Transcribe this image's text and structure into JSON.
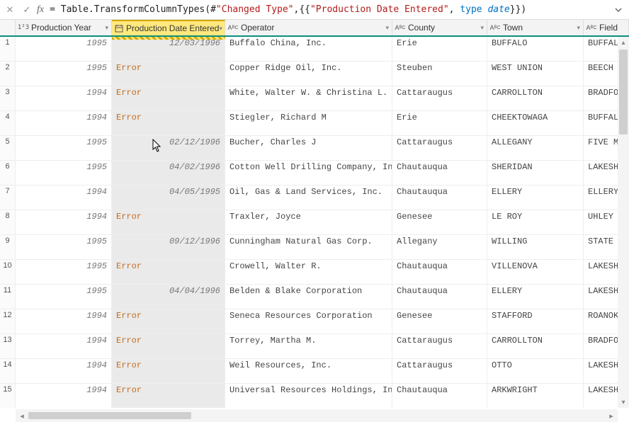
{
  "formula": {
    "prefix": "= Table.TransformColumnTypes(#",
    "str1": "\"Changed Type\"",
    "mid1": ",{{",
    "str2": "\"Production Date Entered\"",
    "mid2": ", ",
    "typ": "type",
    "mid3": " ",
    "dat": "date",
    "suffix": "}})"
  },
  "columns": {
    "prod_year": "Production Year",
    "prod_date": "Production Date Entered",
    "operator": "Operator",
    "county": "County",
    "town": "Town",
    "field": "Field"
  },
  "type_labels": {
    "num": "1²3",
    "txt": "AᴮC"
  },
  "error_label": "Error",
  "rows": [
    {
      "n": "1",
      "year": "1995",
      "date": "12/03/1996",
      "err": false,
      "op": "Buffalo China, Inc.",
      "county": "Erie",
      "town": "BUFFALO",
      "field": "BUFFALO"
    },
    {
      "n": "2",
      "year": "1995",
      "date": "",
      "err": true,
      "op": "Copper Ridge Oil, Inc.",
      "county": "Steuben",
      "town": "WEST UNION",
      "field": "BEECH H"
    },
    {
      "n": "3",
      "year": "1994",
      "date": "",
      "err": true,
      "op": "White, Walter W. & Christina L.",
      "county": "Cattaraugus",
      "town": "CARROLLTON",
      "field": "BRADFOR"
    },
    {
      "n": "4",
      "year": "1994",
      "date": "",
      "err": true,
      "op": "Stiegler, Richard M",
      "county": "Erie",
      "town": "CHEEKTOWAGA",
      "field": "BUFFALO"
    },
    {
      "n": "5",
      "year": "1995",
      "date": "02/12/1996",
      "err": false,
      "op": "Bucher, Charles J",
      "county": "Cattaraugus",
      "town": "ALLEGANY",
      "field": "FIVE MI"
    },
    {
      "n": "6",
      "year": "1995",
      "date": "04/02/1996",
      "err": false,
      "op": "Cotton Well Drilling Company,  Inc.",
      "county": "Chautauqua",
      "town": "SHERIDAN",
      "field": "LAKESHO"
    },
    {
      "n": "7",
      "year": "1994",
      "date": "04/05/1995",
      "err": false,
      "op": "Oil, Gas & Land Services, Inc.",
      "county": "Chautauqua",
      "town": "ELLERY",
      "field": "ELLERY"
    },
    {
      "n": "8",
      "year": "1994",
      "date": "",
      "err": true,
      "op": "Traxler, Joyce",
      "county": "Genesee",
      "town": "LE ROY",
      "field": "UHLEY C"
    },
    {
      "n": "9",
      "year": "1995",
      "date": "09/12/1996",
      "err": false,
      "op": "Cunningham Natural Gas Corp.",
      "county": "Allegany",
      "town": "WILLING",
      "field": "STATE L"
    },
    {
      "n": "10",
      "year": "1995",
      "date": "",
      "err": true,
      "op": "Crowell, Walter R.",
      "county": "Chautauqua",
      "town": "VILLENOVA",
      "field": "LAKESHO"
    },
    {
      "n": "11",
      "year": "1995",
      "date": "04/04/1996",
      "err": false,
      "op": "Belden & Blake Corporation",
      "county": "Chautauqua",
      "town": "ELLERY",
      "field": "LAKESHO"
    },
    {
      "n": "12",
      "year": "1994",
      "date": "",
      "err": true,
      "op": "Seneca Resources Corporation",
      "county": "Genesee",
      "town": "STAFFORD",
      "field": "ROANOKE"
    },
    {
      "n": "13",
      "year": "1994",
      "date": "",
      "err": true,
      "op": "Torrey, Martha M.",
      "county": "Cattaraugus",
      "town": "CARROLLTON",
      "field": "BRADFOR"
    },
    {
      "n": "14",
      "year": "1994",
      "date": "",
      "err": true,
      "op": "Weil Resources, Inc.",
      "county": "Cattaraugus",
      "town": "OTTO",
      "field": "LAKESHO"
    },
    {
      "n": "15",
      "year": "1994",
      "date": "",
      "err": true,
      "op": "Universal Resources Holdings, Incorp.",
      "county": "Chautauqua",
      "town": "ARKWRIGHT",
      "field": "LAKESHO"
    }
  ]
}
